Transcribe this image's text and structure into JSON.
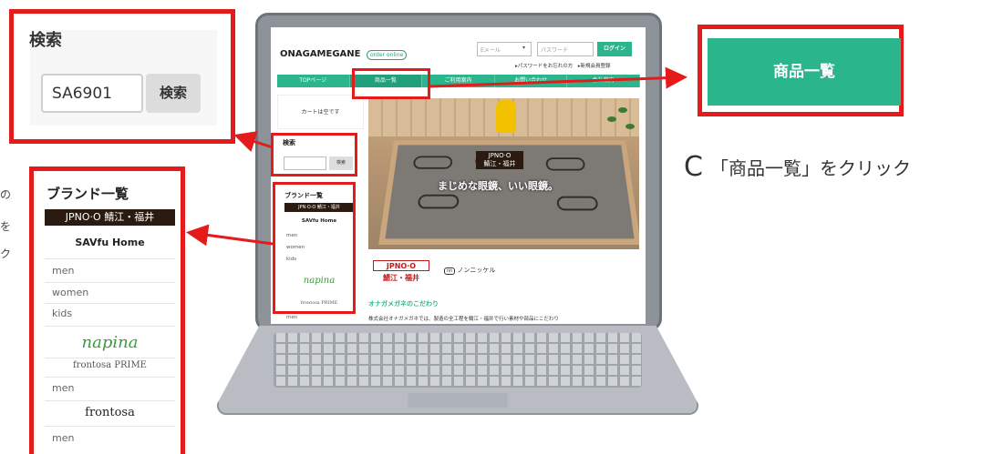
{
  "site": {
    "logo": "ONAGAMEGANE",
    "order_badge": "order online",
    "email_placeholder": "Eメール",
    "password_placeholder": "パスワード",
    "login_label": "ログイン",
    "header_links": "▸パスワードをお忘れの方　▸新規会員登録",
    "nav": [
      "TOPページ",
      "商品一覧",
      "ご利用案内",
      "お問い合わせ",
      "会社案内"
    ],
    "cart_text": "カートは空です",
    "search_title": "検索",
    "search_button": "検索",
    "brand_title": "ブランド一覧",
    "brand_jpn": "JPN·O·O 鯖江・福井",
    "brand_savfu": "SAVfu Home",
    "categories": [
      "men",
      "women",
      "kids"
    ],
    "brand_napina": "napina",
    "brand_frontosa_prime": "frontosa PRIME",
    "brand_men": "men",
    "hero_brand_line1": "JPNO·O",
    "hero_brand_line2": "鯖江・福井",
    "hero_text": "まじめな眼鏡、いい眼鏡。",
    "content_logo_line1": "JPNO·O",
    "content_logo_line2": "鯖江・福井",
    "non_nickel_mark": "nn",
    "non_nickel_text": "ノンニッケル",
    "kodawari_title": "オナガメガネのこだわり",
    "kodawari_body": "株式会社オナガメガネでは、製造の全工程を鯖江・福井で行い素材や部品にこだわり"
  },
  "callout_search": {
    "title": "検索",
    "input_value": "SA6901",
    "button": "検索"
  },
  "callout_products": {
    "label": "商品一覧"
  },
  "callout_brands": {
    "title": "ブランド一覧",
    "jpn": "JPNO·O 鯖江・福井",
    "savfu": "SAVfu Home",
    "categories": [
      "men",
      "women",
      "kids"
    ],
    "napina": "napina",
    "frontosa_prime": "frontosa PRIME",
    "men_after_prime": "men",
    "frontosa": "frontosa",
    "men_after_frontosa": "men"
  },
  "step": {
    "letter": "C",
    "text": "「商品一覧」をクリック"
  },
  "edge_glyphs": [
    "の",
    "を",
    "ク"
  ],
  "colors": {
    "accent_green": "#2bb58c",
    "highlight_red": "#e51a1a",
    "brand_dark": "#2a1a10"
  }
}
